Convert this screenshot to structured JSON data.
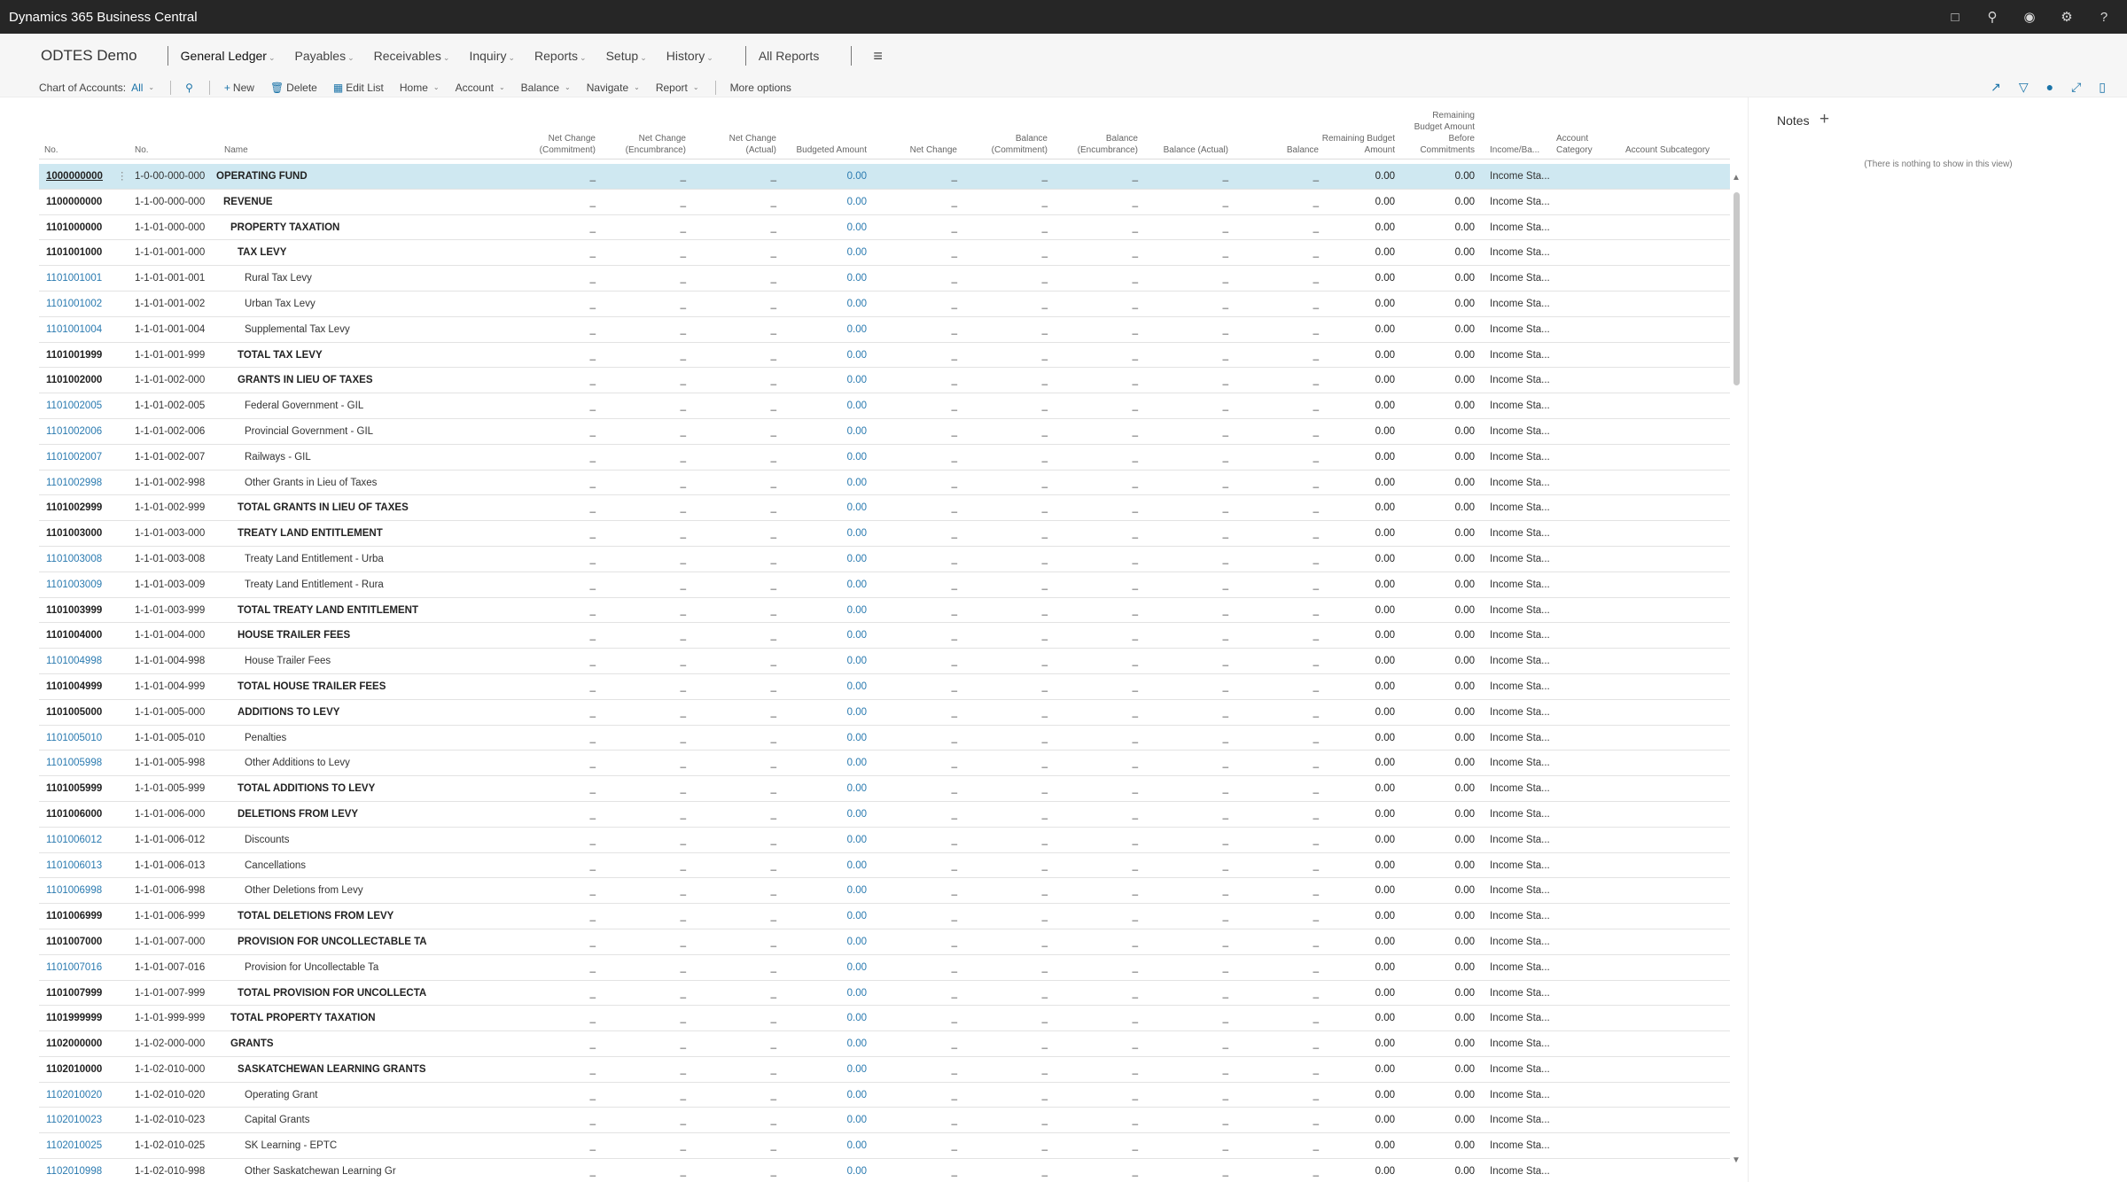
{
  "app": {
    "title": "Dynamics 365 Business Central"
  },
  "topbar_icons": [
    "document-icon",
    "search-icon",
    "bell-icon",
    "gear-icon",
    "help-icon"
  ],
  "nav": {
    "company": "ODTES Demo",
    "items": [
      "General Ledger",
      "Payables",
      "Receivables",
      "Inquiry",
      "Reports",
      "Setup",
      "History"
    ],
    "all_reports": "All Reports"
  },
  "actions": {
    "filter_label": "Chart of Accounts:",
    "filter_value": "All",
    "new": "New",
    "delete": "Delete",
    "edit_list": "Edit List",
    "home": "Home",
    "account": "Account",
    "balance": "Balance",
    "navigate": "Navigate",
    "report": "Report",
    "more": "More options"
  },
  "columns": {
    "no": "No.",
    "no2": "No.",
    "name": "Name",
    "net_change_commitment": "Net Change (Commitment)",
    "net_change_encumbrance": "Net Change (Encumbrance)",
    "net_change_actual": "Net Change (Actual)",
    "budgeted_amount": "Budgeted Amount",
    "net_change": "Net Change",
    "balance_commitment": "Balance (Commitment)",
    "balance_encumbrance": "Balance (Encumbrance)",
    "balance_actual": "Balance (Actual)",
    "balance": "Balance",
    "remaining_budget": "Remaining Budget Amount",
    "remaining_budget_before": "Remaining Budget Amount Before Commitments",
    "income_balance": "Income/Ba...",
    "account_category": "Account Category",
    "account_subcategory": "Account Subcategory"
  },
  "cell_values": {
    "dash": "_",
    "zero": "0.00",
    "income": "Income Sta..."
  },
  "rows": [
    {
      "no": "1000000000",
      "no2": "1-0-00-000-000",
      "name": "OPERATING FUND",
      "bold": true,
      "indent": 0
    },
    {
      "no": "1100000000",
      "no2": "1-1-00-000-000",
      "name": "REVENUE",
      "bold": true,
      "indent": 1
    },
    {
      "no": "1101000000",
      "no2": "1-1-01-000-000",
      "name": "PROPERTY TAXATION",
      "bold": true,
      "indent": 2
    },
    {
      "no": "1101001000",
      "no2": "1-1-01-001-000",
      "name": "TAX LEVY",
      "bold": true,
      "indent": 3
    },
    {
      "no": "1101001001",
      "no2": "1-1-01-001-001",
      "name": "Rural Tax Levy",
      "bold": false,
      "indent": 4
    },
    {
      "no": "1101001002",
      "no2": "1-1-01-001-002",
      "name": "Urban Tax Levy",
      "bold": false,
      "indent": 4
    },
    {
      "no": "1101001004",
      "no2": "1-1-01-001-004",
      "name": "Supplemental Tax Levy",
      "bold": false,
      "indent": 4
    },
    {
      "no": "1101001999",
      "no2": "1-1-01-001-999",
      "name": "TOTAL TAX LEVY",
      "bold": true,
      "indent": 3
    },
    {
      "no": "1101002000",
      "no2": "1-1-01-002-000",
      "name": "GRANTS IN LIEU OF TAXES",
      "bold": true,
      "indent": 3
    },
    {
      "no": "1101002005",
      "no2": "1-1-01-002-005",
      "name": "Federal Government - GIL",
      "bold": false,
      "indent": 4
    },
    {
      "no": "1101002006",
      "no2": "1-1-01-002-006",
      "name": "Provincial Government - GIL",
      "bold": false,
      "indent": 4
    },
    {
      "no": "1101002007",
      "no2": "1-1-01-002-007",
      "name": "Railways - GIL",
      "bold": false,
      "indent": 4
    },
    {
      "no": "1101002998",
      "no2": "1-1-01-002-998",
      "name": "Other Grants in Lieu of Taxes",
      "bold": false,
      "indent": 4
    },
    {
      "no": "1101002999",
      "no2": "1-1-01-002-999",
      "name": "TOTAL GRANTS IN LIEU OF TAXES",
      "bold": true,
      "indent": 3
    },
    {
      "no": "1101003000",
      "no2": "1-1-01-003-000",
      "name": "TREATY LAND ENTITLEMENT",
      "bold": true,
      "indent": 3
    },
    {
      "no": "1101003008",
      "no2": "1-1-01-003-008",
      "name": "Treaty Land Entitlement - Urba",
      "bold": false,
      "indent": 4
    },
    {
      "no": "1101003009",
      "no2": "1-1-01-003-009",
      "name": "Treaty Land Entitlement - Rura",
      "bold": false,
      "indent": 4
    },
    {
      "no": "1101003999",
      "no2": "1-1-01-003-999",
      "name": "TOTAL TREATY LAND ENTITLEMENT",
      "bold": true,
      "indent": 3
    },
    {
      "no": "1101004000",
      "no2": "1-1-01-004-000",
      "name": "HOUSE TRAILER FEES",
      "bold": true,
      "indent": 3
    },
    {
      "no": "1101004998",
      "no2": "1-1-01-004-998",
      "name": "House Trailer Fees",
      "bold": false,
      "indent": 4
    },
    {
      "no": "1101004999",
      "no2": "1-1-01-004-999",
      "name": "TOTAL HOUSE TRAILER FEES",
      "bold": true,
      "indent": 3
    },
    {
      "no": "1101005000",
      "no2": "1-1-01-005-000",
      "name": "ADDITIONS TO LEVY",
      "bold": true,
      "indent": 3
    },
    {
      "no": "1101005010",
      "no2": "1-1-01-005-010",
      "name": "Penalties",
      "bold": false,
      "indent": 4
    },
    {
      "no": "1101005998",
      "no2": "1-1-01-005-998",
      "name": "Other Additions to Levy",
      "bold": false,
      "indent": 4
    },
    {
      "no": "1101005999",
      "no2": "1-1-01-005-999",
      "name": "TOTAL ADDITIONS TO LEVY",
      "bold": true,
      "indent": 3
    },
    {
      "no": "1101006000",
      "no2": "1-1-01-006-000",
      "name": "DELETIONS FROM LEVY",
      "bold": true,
      "indent": 3
    },
    {
      "no": "1101006012",
      "no2": "1-1-01-006-012",
      "name": "Discounts",
      "bold": false,
      "indent": 4
    },
    {
      "no": "1101006013",
      "no2": "1-1-01-006-013",
      "name": "Cancellations",
      "bold": false,
      "indent": 4
    },
    {
      "no": "1101006998",
      "no2": "1-1-01-006-998",
      "name": "Other Deletions from Levy",
      "bold": false,
      "indent": 4
    },
    {
      "no": "1101006999",
      "no2": "1-1-01-006-999",
      "name": "TOTAL DELETIONS FROM LEVY",
      "bold": true,
      "indent": 3
    },
    {
      "no": "1101007000",
      "no2": "1-1-01-007-000",
      "name": "PROVISION FOR UNCOLLECTABLE TA",
      "bold": true,
      "indent": 3
    },
    {
      "no": "1101007016",
      "no2": "1-1-01-007-016",
      "name": "Provision for Uncollectable Ta",
      "bold": false,
      "indent": 4
    },
    {
      "no": "1101007999",
      "no2": "1-1-01-007-999",
      "name": "TOTAL PROVISION FOR UNCOLLECTA",
      "bold": true,
      "indent": 3
    },
    {
      "no": "1101999999",
      "no2": "1-1-01-999-999",
      "name": "TOTAL PROPERTY TAXATION",
      "bold": true,
      "indent": 2
    },
    {
      "no": "1102000000",
      "no2": "1-1-02-000-000",
      "name": "GRANTS",
      "bold": true,
      "indent": 2
    },
    {
      "no": "1102010000",
      "no2": "1-1-02-010-000",
      "name": "SASKATCHEWAN LEARNING GRANTS",
      "bold": true,
      "indent": 3
    },
    {
      "no": "1102010020",
      "no2": "1-1-02-010-020",
      "name": "Operating Grant",
      "bold": false,
      "indent": 4
    },
    {
      "no": "1102010023",
      "no2": "1-1-02-010-023",
      "name": "Capital Grants",
      "bold": false,
      "indent": 4
    },
    {
      "no": "1102010025",
      "no2": "1-1-02-010-025",
      "name": "SK Learning - EPTC",
      "bold": false,
      "indent": 4
    },
    {
      "no": "1102010998",
      "no2": "1-1-02-010-998",
      "name": "Other Saskatchewan Learning Gr",
      "bold": false,
      "indent": 4
    }
  ],
  "notes": {
    "title": "Notes",
    "empty": "(There is nothing to show in this view)"
  }
}
